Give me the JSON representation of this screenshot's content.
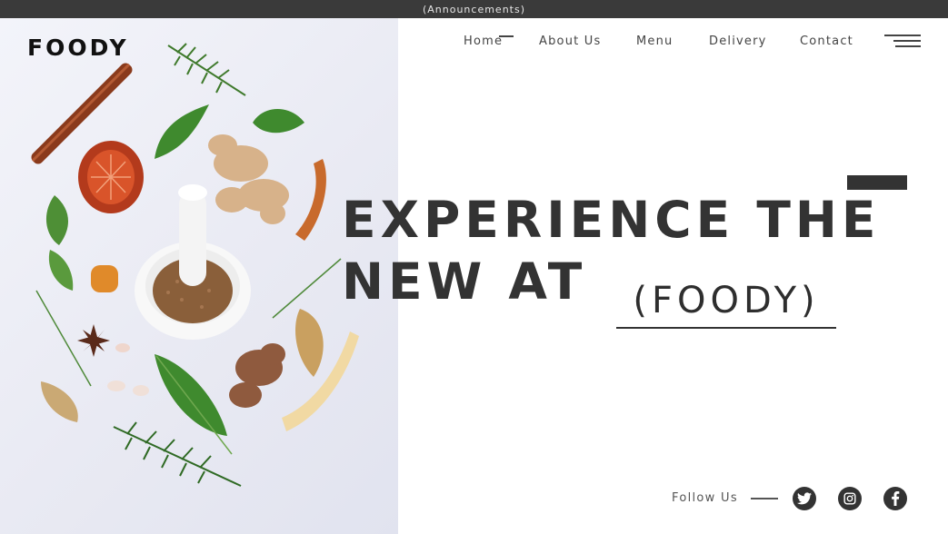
{
  "announcement": "(Announcements)",
  "logo": "FOODY",
  "nav": {
    "items": [
      {
        "label": "Home"
      },
      {
        "label": "About Us"
      },
      {
        "label": "Menu"
      },
      {
        "label": "Delivery"
      },
      {
        "label": "Contact"
      }
    ],
    "menu_icon": "hamburger-icon"
  },
  "hero": {
    "headline_line1": "EXPERIENCE THE",
    "headline_line2": "NEW AT",
    "brand_tag": "(FOODY)",
    "image": "spices-herbs-mortar-pestle"
  },
  "footer": {
    "follow_label": "Follow Us",
    "social_icons": [
      "twitter-icon",
      "instagram-icon",
      "facebook-icon"
    ]
  },
  "colors": {
    "bar": "#3a3a3a",
    "text_dark": "#333333",
    "background": "#ffffff",
    "hero_bg": "#eceef5"
  }
}
